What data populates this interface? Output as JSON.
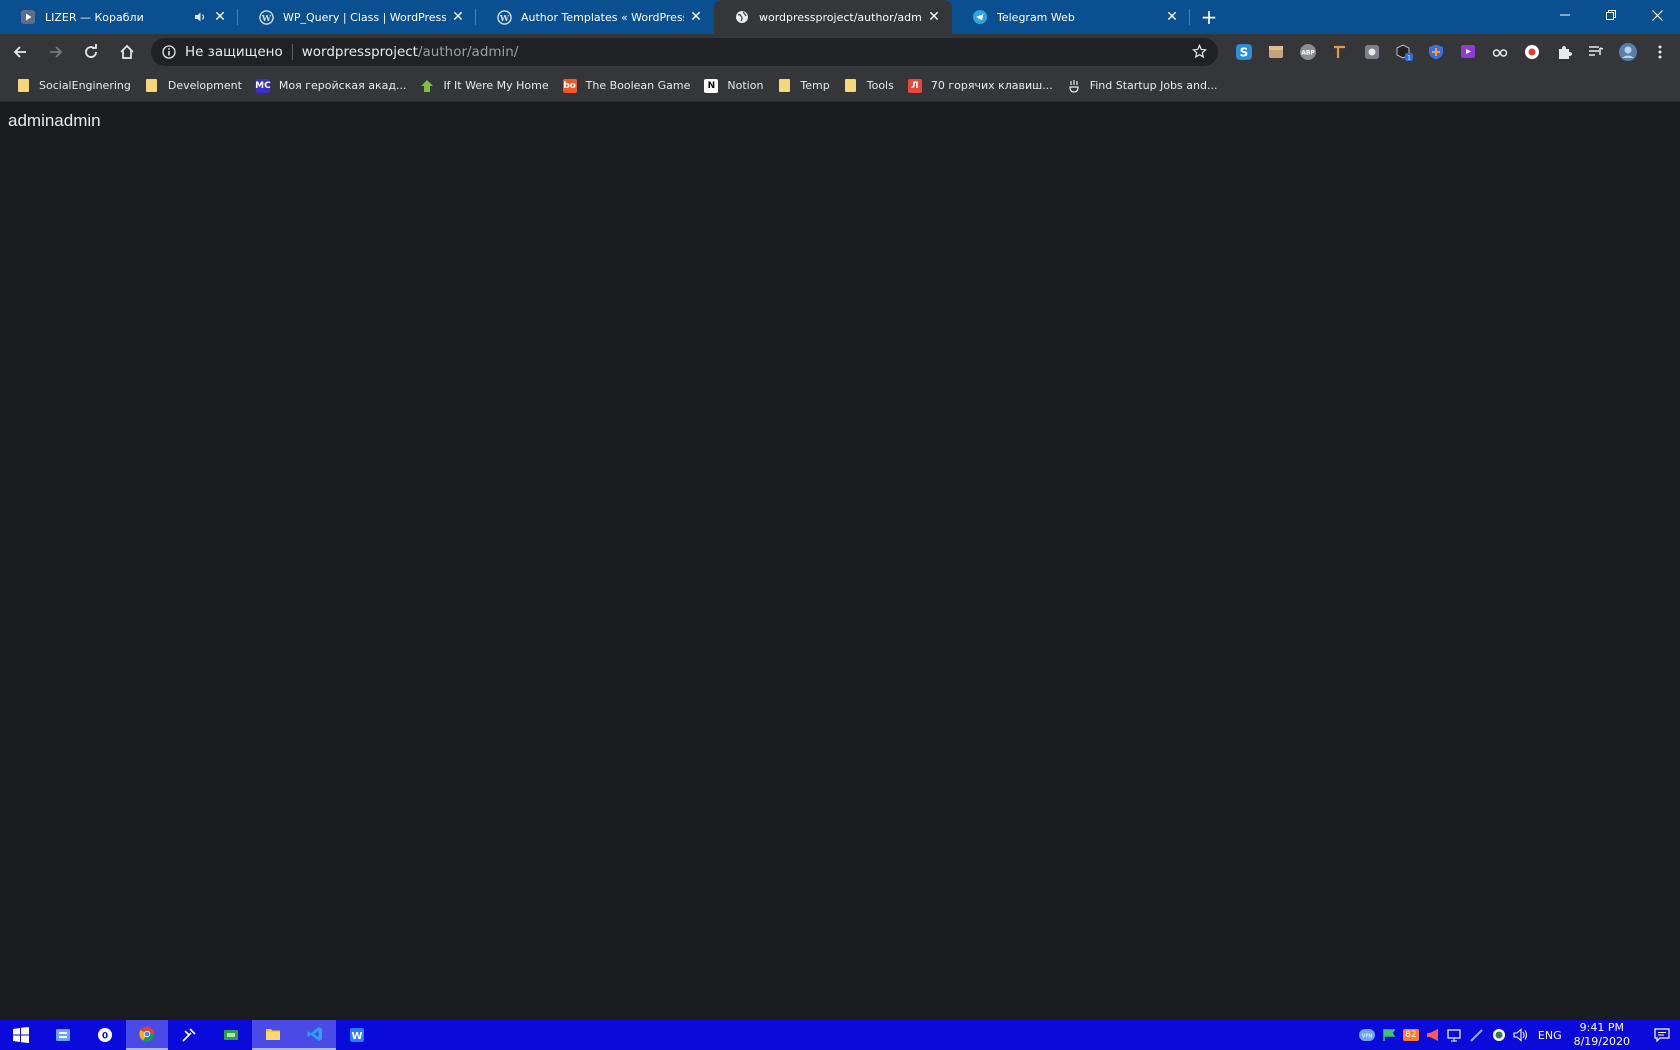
{
  "tabs": [
    {
      "title": "LIZER — Корабли",
      "icon": "youtube-play-icon",
      "audio": true,
      "active": false
    },
    {
      "title": "WP_Query | Class | WordPress Devel",
      "icon": "wordpress-icon",
      "active": false
    },
    {
      "title": "Author Templates « WordPress Code",
      "icon": "wordpress-icon",
      "active": false
    },
    {
      "title": "wordpressproject/author/admin/",
      "icon": "globe-icon",
      "active": true
    },
    {
      "title": "Telegram Web",
      "icon": "telegram-icon",
      "active": false
    }
  ],
  "omnibox": {
    "security": "Не защищено",
    "host": "wordpressproject",
    "path": "/author/admin/"
  },
  "bookmarks": [
    {
      "label": "SocialEnginering",
      "icon": "folder-icon"
    },
    {
      "label": "Development",
      "icon": "folder-icon"
    },
    {
      "label": "Моя геройская акад...",
      "icon": "mc-icon"
    },
    {
      "label": "If It Were My Home",
      "icon": "home-arrow-icon"
    },
    {
      "label": "The Boolean Game",
      "icon": "bo-icon"
    },
    {
      "label": "Notion",
      "icon": "notion-icon"
    },
    {
      "label": "Temp",
      "icon": "folder-icon"
    },
    {
      "label": "Tools",
      "icon": "folder-icon"
    },
    {
      "label": "70 горячих клавиш...",
      "icon": "l-icon"
    },
    {
      "label": "Find Startup Jobs and...",
      "icon": "angellist-icon"
    }
  ],
  "page": {
    "author_name": "adminadmin"
  },
  "taskbar": {
    "tray_badge": "82",
    "language": "ENG",
    "time": "9:41 PM",
    "date": "8/19/2020"
  },
  "colors": {
    "titlebar": "#0a4f8f",
    "toolbar": "#35363a",
    "page_bg": "#1b1c1e",
    "taskbar": "#0a0adb"
  }
}
